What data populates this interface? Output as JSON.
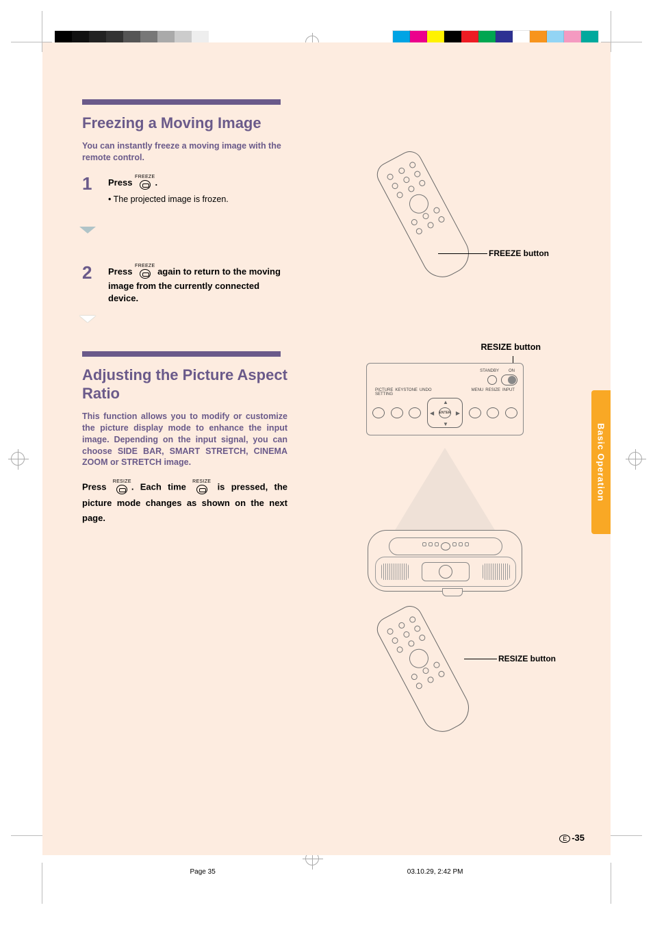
{
  "sections": {
    "freeze": {
      "title": "Freezing a Moving Image",
      "intro": "You can instantly freeze a moving image with the remote control.",
      "step1": {
        "num": "1",
        "lead_a": "Press ",
        "icon_label": "FREEZE",
        "lead_b": ".",
        "bullet": "The projected image is frozen."
      },
      "step2": {
        "num": "2",
        "lead_a": "Press ",
        "icon_label": "FREEZE",
        "lead_b": " again to return to the moving image from the currently connected device."
      }
    },
    "aspect": {
      "title": "Adjusting the Picture Aspect Ratio",
      "intro": "This function allows you to modify or customize the picture display mode to enhance the input image. Depending on the input signal, you can choose SIDE BAR, SMART STRETCH, CINEMA ZOOM or STRETCH image.",
      "press_a": "Press ",
      "icon_label": "RESIZE",
      "press_b": ". Each time ",
      "press_c": " is pressed, the picture mode changes as shown on the next page."
    }
  },
  "callouts": {
    "freeze_button": "FREEZE button",
    "resize_button_top": "RESIZE button",
    "resize_button_bottom": "RESIZE button"
  },
  "panel_labels": {
    "standby": "STANDBY",
    "on": "ON",
    "picture_setting": "PICTURE\nSETTING",
    "keystone": "KEYSTONE",
    "undo": "UNDO",
    "menu": "MENU",
    "resize": "RESIZE",
    "input": "INPUT",
    "enter": "ENTER"
  },
  "side_tab": "Basic Operation",
  "page_number": "-35",
  "page_letter": "E",
  "footer": {
    "page": "Page 35",
    "timestamp": "03.10.29, 2:42 PM"
  }
}
